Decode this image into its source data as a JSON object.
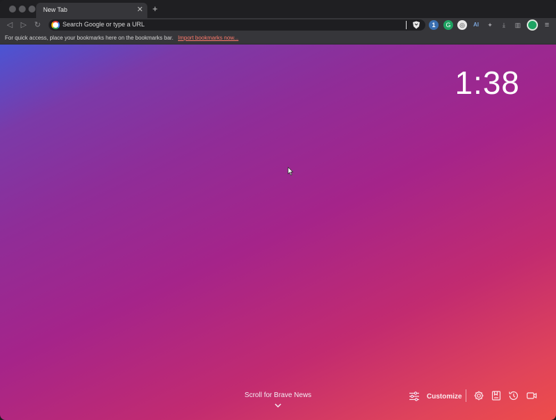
{
  "tab": {
    "title": "New Tab",
    "close_glyph": "✕",
    "new_tab_glyph": "+"
  },
  "toolbar": {
    "back_glyph": "◁",
    "forward_glyph": "▷",
    "reload_glyph": "↻",
    "omnibox_text": "Search Google or type a URL",
    "extensions": [
      {
        "name": "1password-icon",
        "glyph": "1"
      },
      {
        "name": "grammarly-icon",
        "glyph": "G"
      },
      {
        "name": "chatgpt-icon",
        "glyph": "◎"
      },
      {
        "name": "ext-badge-icon",
        "glyph": "AI"
      },
      {
        "name": "puzzle-icon",
        "glyph": "✦"
      },
      {
        "name": "download-icon",
        "glyph": "⤓"
      },
      {
        "name": "sidebar-icon",
        "glyph": "▥"
      },
      {
        "name": "menu-icon",
        "glyph": "≡"
      }
    ]
  },
  "bookmarks_bar": {
    "hint": "For quick access, place your bookmarks here on the bookmarks bar.",
    "import_link": "Import bookmarks now..."
  },
  "new_tab": {
    "clock": "1:38",
    "scroll_label": "Scroll for Brave News",
    "customize_label": "Customize"
  },
  "colors": {
    "gradient_start": "#4a55d4",
    "gradient_mid": "#a5248a",
    "gradient_end": "#ee4d49",
    "import_link": "#ff7a6b"
  }
}
